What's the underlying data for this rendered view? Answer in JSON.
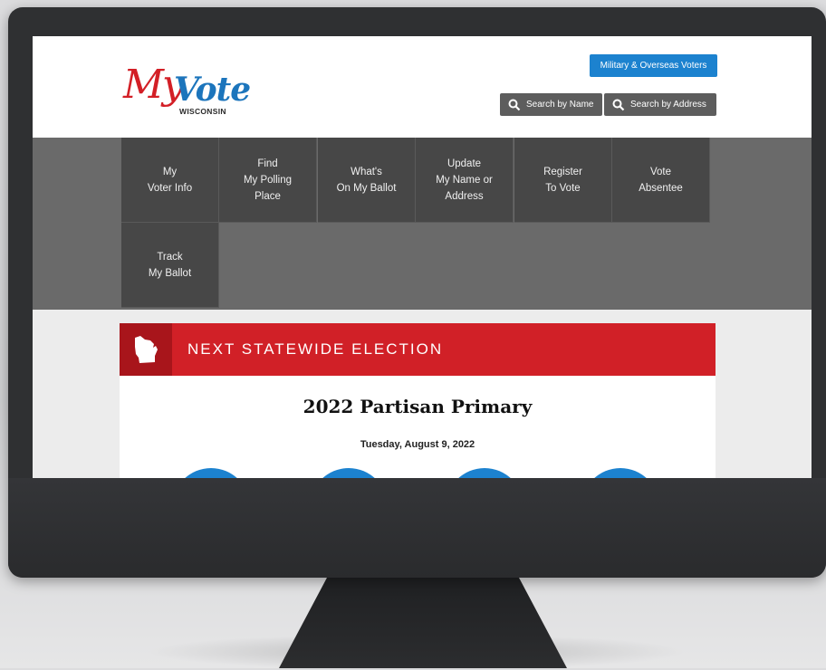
{
  "logo": {
    "script_my": "My",
    "script_vote": "Vote",
    "subtitle": "WISCONSIN"
  },
  "header": {
    "military_button": "Military & Overseas Voters",
    "search_name_button": "Search by Name",
    "search_address_button": "Search by Address"
  },
  "nav": {
    "items": [
      {
        "label": "My\nVoter Info",
        "name": "nav-my-voter-info"
      },
      {
        "label": "Find\nMy Polling\nPlace",
        "name": "nav-find-polling-place"
      },
      {
        "label": "What's\nOn My Ballot",
        "name": "nav-whats-on-my-ballot"
      },
      {
        "label": "Update\nMy Name or\nAddress",
        "name": "nav-update-name-address"
      },
      {
        "label": "Register\nTo Vote",
        "name": "nav-register-to-vote"
      },
      {
        "label": "Vote\nAbsentee",
        "name": "nav-vote-absentee"
      },
      {
        "label": "Track\nMy Ballot",
        "name": "nav-track-my-ballot"
      }
    ]
  },
  "election": {
    "banner_title": "NEXT STATEWIDE ELECTION",
    "title": "2022 Partisan Primary",
    "date": "Tuesday, August 9, 2022"
  },
  "colors": {
    "brand_red": "#d12027",
    "brand_blue": "#1c82cf",
    "nav_gray": "#474747"
  }
}
